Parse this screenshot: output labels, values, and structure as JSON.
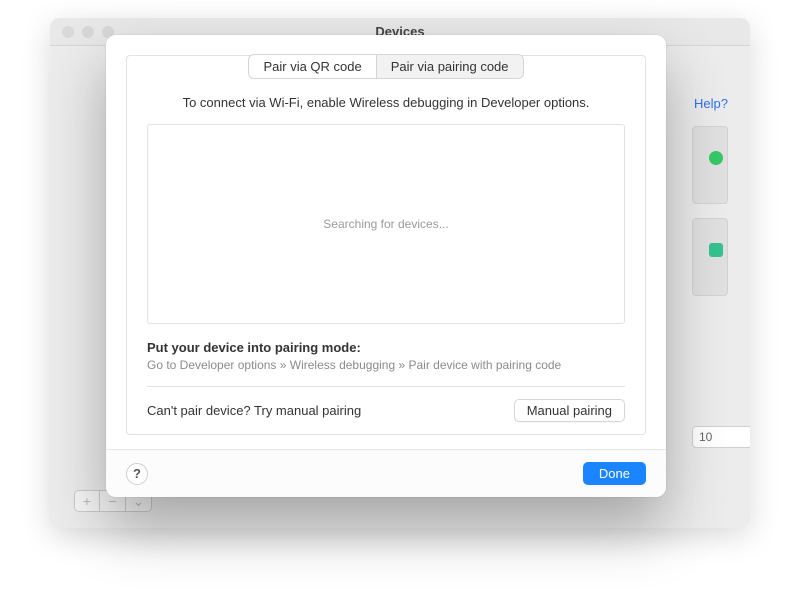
{
  "background": {
    "title": "Devices",
    "help_label": "Help?",
    "field_value": "10",
    "bottom_btns": {
      "plus": "+",
      "minus": "−",
      "eye": "⌄"
    }
  },
  "modal": {
    "tabs": {
      "qr": "Pair via QR code",
      "pairing_code": "Pair via pairing code"
    },
    "instructions": "To connect via Wi-Fi, enable Wireless debugging in Developer options.",
    "searching": "Searching for devices...",
    "pair_title": "Put your device into pairing mode:",
    "pair_sub": "Go to Developer options » Wireless debugging » Pair device with pairing code",
    "manual_text": "Can't pair device? Try manual pairing",
    "manual_button": "Manual pairing",
    "help": "?",
    "done": "Done"
  }
}
